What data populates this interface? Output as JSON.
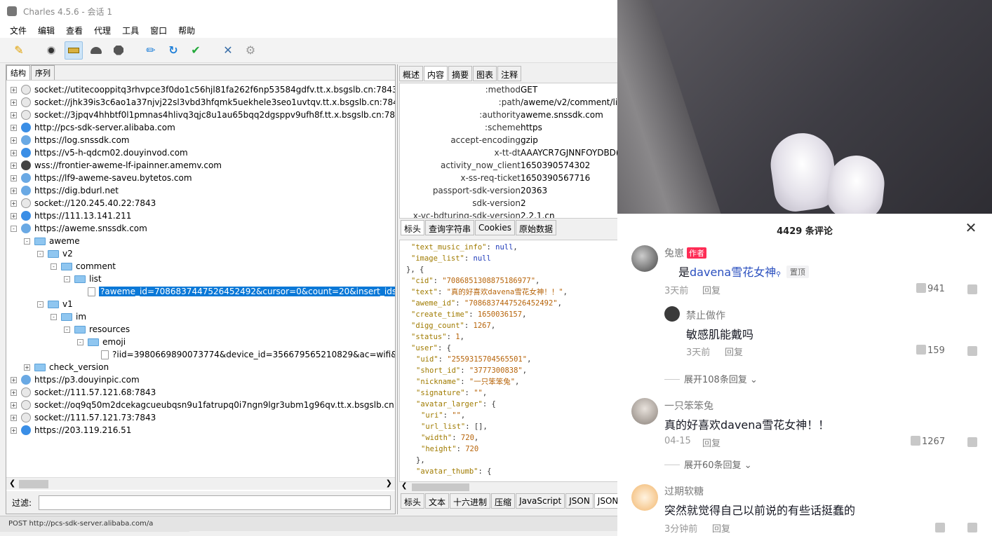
{
  "charles": {
    "title": "Charles 4.5.6 - 会话 1",
    "menu": [
      "文件",
      "编辑",
      "查看",
      "代理",
      "工具",
      "窗口",
      "帮助"
    ],
    "toolbar": [
      "broom-icon",
      "record-icon",
      "throttle-icon",
      "turtle-icon",
      "stop-icon",
      "pen-icon",
      "refresh-icon",
      "check-icon",
      "tools-icon",
      "settings-icon"
    ],
    "left_tabs": [
      "结构",
      "序列"
    ],
    "tree": [
      {
        "depth": 0,
        "exp": "+",
        "icon": "sock",
        "text": "socket://utitecooppitq3rhvpce3f0do1c56hjl81fa262f6np53584gdfv.tt.x.bsgslb.cn:7843"
      },
      {
        "depth": 0,
        "exp": "+",
        "icon": "sock",
        "text": "socket://jhk39is3c6ao1a37njvj22sl3vbd3hfqmk5uekhele3seo1uvtqv.tt.x.bsgslb.cn:7843"
      },
      {
        "depth": 0,
        "exp": "+",
        "icon": "sock",
        "text": "socket://3jpqv4hhbtf0l1pmnas4hlivq3qjc8u1au65bqq2dgsppv9ufh8f.tt.x.bsgslb.cn:7843"
      },
      {
        "depth": 0,
        "exp": "+",
        "icon": "web",
        "text": "http://pcs-sdk-server.alibaba.com"
      },
      {
        "depth": 0,
        "exp": "+",
        "icon": "bolt",
        "text": "https://log.snssdk.com"
      },
      {
        "depth": 0,
        "exp": "+",
        "icon": "web",
        "text": "https://v5-h-qdcm02.douyinvod.com"
      },
      {
        "depth": 0,
        "exp": "+",
        "icon": "wss",
        "text": "wss://frontier-aweme-lf-ipainner.amemv.com"
      },
      {
        "depth": 0,
        "exp": "+",
        "icon": "bolt",
        "text": "https://lf9-aweme-saveu.bytetos.com"
      },
      {
        "depth": 0,
        "exp": "+",
        "icon": "bolt",
        "text": "https://dig.bdurl.net"
      },
      {
        "depth": 0,
        "exp": "+",
        "icon": "sock",
        "text": "socket://120.245.40.22:7843"
      },
      {
        "depth": 0,
        "exp": "+",
        "icon": "web",
        "text": "https://111.13.141.211"
      },
      {
        "depth": 0,
        "exp": "-",
        "icon": "bolt",
        "text": "https://aweme.snssdk.com"
      },
      {
        "depth": 1,
        "exp": "-",
        "icon": "fold",
        "text": "aweme"
      },
      {
        "depth": 2,
        "exp": "-",
        "icon": "fold",
        "text": "v2"
      },
      {
        "depth": 3,
        "exp": "-",
        "icon": "fold",
        "text": "comment"
      },
      {
        "depth": 4,
        "exp": "-",
        "icon": "fold",
        "text": "list"
      },
      {
        "depth": 5,
        "exp": "",
        "icon": "file",
        "text": "?aweme_id=7086837447526452492&cursor=0&count=20&insert_ids&a",
        "selected": true
      },
      {
        "depth": 2,
        "exp": "-",
        "icon": "fold",
        "text": "v1"
      },
      {
        "depth": 3,
        "exp": "-",
        "icon": "fold",
        "text": "im"
      },
      {
        "depth": 4,
        "exp": "-",
        "icon": "fold",
        "text": "resources"
      },
      {
        "depth": 5,
        "exp": "-",
        "icon": "fold",
        "text": "emoji"
      },
      {
        "depth": 6,
        "exp": "",
        "icon": "file",
        "text": "?iid=3980669890073774&device_id=356679565210829&ac=wifi&cha"
      },
      {
        "depth": 1,
        "exp": "+",
        "icon": "fold",
        "text": "check_version"
      },
      {
        "depth": 0,
        "exp": "+",
        "icon": "bolt",
        "text": "https://p3.douyinpic.com"
      },
      {
        "depth": 0,
        "exp": "+",
        "icon": "sock",
        "text": "socket://111.57.121.68:7843"
      },
      {
        "depth": 0,
        "exp": "+",
        "icon": "sock",
        "text": "socket://oq9q50m2dcekagcueubqsn9u1fatrupq0i7ngn9lgr3ubm1g96qv.tt.x.bsgslb.cn:78"
      },
      {
        "depth": 0,
        "exp": "+",
        "icon": "sock",
        "text": "socket://111.57.121.73:7843"
      },
      {
        "depth": 0,
        "exp": "+",
        "icon": "web",
        "text": "https://203.119.216.51"
      }
    ],
    "filter_label": "过滤:",
    "filter_value": "",
    "right_tabs": [
      "概述",
      "内容",
      "摘要",
      "图表",
      "注释"
    ],
    "headers": [
      {
        "k": ":method",
        "v": "GET"
      },
      {
        "k": ":path",
        "v": "/aweme/v2/comment/lis"
      },
      {
        "k": ":authority",
        "v": "aweme.snssdk.com"
      },
      {
        "k": ":scheme",
        "v": "https"
      },
      {
        "k": "accept-encoding",
        "v": "gzip"
      },
      {
        "k": "x-tt-dt",
        "v": "AAAYCR7GJNNFOYDBD("
      },
      {
        "k": "activity_now_client",
        "v": "1650390574302"
      },
      {
        "k": "x-ss-req-ticket",
        "v": "1650390567716"
      },
      {
        "k": "passport-sdk-version",
        "v": "20363"
      },
      {
        "k": "sdk-version",
        "v": "2"
      },
      {
        "k": "x-vc-bdturing-sdk-version",
        "v": "2.2.1.cn"
      }
    ],
    "req_tabs": [
      "标头",
      "查询字符串",
      "Cookies",
      "原始数据"
    ],
    "json_lines": [
      {
        "ind": 2,
        "parts": [
          [
            "k",
            "\"text_music_info\""
          ],
          [
            "p",
            ": "
          ],
          [
            "b",
            "null"
          ],
          [
            "p",
            ","
          ]
        ]
      },
      {
        "ind": 2,
        "parts": [
          [
            "k",
            "\"image_list\""
          ],
          [
            "p",
            ": "
          ],
          [
            "b",
            "null"
          ]
        ]
      },
      {
        "ind": 1,
        "parts": [
          [
            "p",
            "}, {"
          ]
        ]
      },
      {
        "ind": 2,
        "parts": [
          [
            "k",
            "\"cid\""
          ],
          [
            "p",
            ": "
          ],
          [
            "s",
            "\"7086851308875186977\""
          ],
          [
            "p",
            ","
          ]
        ]
      },
      {
        "ind": 2,
        "parts": [
          [
            "k",
            "\"text\""
          ],
          [
            "p",
            ": "
          ],
          [
            "s",
            "\"真的好喜欢davena雪花女神！！\""
          ],
          [
            "p",
            ","
          ]
        ]
      },
      {
        "ind": 2,
        "parts": [
          [
            "k",
            "\"aweme_id\""
          ],
          [
            "p",
            ": "
          ],
          [
            "s",
            "\"7086837447526452492\""
          ],
          [
            "p",
            ","
          ]
        ]
      },
      {
        "ind": 2,
        "parts": [
          [
            "k",
            "\"create_time\""
          ],
          [
            "p",
            ": "
          ],
          [
            "n",
            "1650036157"
          ],
          [
            "p",
            ","
          ]
        ]
      },
      {
        "ind": 2,
        "parts": [
          [
            "k",
            "\"digg_count\""
          ],
          [
            "p",
            ": "
          ],
          [
            "n",
            "1267"
          ],
          [
            "p",
            ","
          ]
        ]
      },
      {
        "ind": 2,
        "parts": [
          [
            "k",
            "\"status\""
          ],
          [
            "p",
            ": "
          ],
          [
            "n",
            "1"
          ],
          [
            "p",
            ","
          ]
        ]
      },
      {
        "ind": 2,
        "parts": [
          [
            "k",
            "\"user\""
          ],
          [
            "p",
            ": {"
          ]
        ]
      },
      {
        "ind": 3,
        "parts": [
          [
            "k",
            "\"uid\""
          ],
          [
            "p",
            ": "
          ],
          [
            "s",
            "\"2559315704565501\""
          ],
          [
            "p",
            ","
          ]
        ]
      },
      {
        "ind": 3,
        "parts": [
          [
            "k",
            "\"short_id\""
          ],
          [
            "p",
            ": "
          ],
          [
            "s",
            "\"3777300838\""
          ],
          [
            "p",
            ","
          ]
        ]
      },
      {
        "ind": 3,
        "parts": [
          [
            "k",
            "\"nickname\""
          ],
          [
            "p",
            ": "
          ],
          [
            "s",
            "\"一只笨笨兔\""
          ],
          [
            "p",
            ","
          ]
        ]
      },
      {
        "ind": 3,
        "parts": [
          [
            "k",
            "\"signature\""
          ],
          [
            "p",
            ": "
          ],
          [
            "s",
            "\"\""
          ],
          [
            "p",
            ","
          ]
        ]
      },
      {
        "ind": 3,
        "parts": [
          [
            "k",
            "\"avatar_larger\""
          ],
          [
            "p",
            ": {"
          ]
        ]
      },
      {
        "ind": 4,
        "parts": [
          [
            "k",
            "\"uri\""
          ],
          [
            "p",
            ": "
          ],
          [
            "s",
            "\"\""
          ],
          [
            "p",
            ","
          ]
        ]
      },
      {
        "ind": 4,
        "parts": [
          [
            "k",
            "\"url_list\""
          ],
          [
            "p",
            ": [],"
          ]
        ]
      },
      {
        "ind": 4,
        "parts": [
          [
            "k",
            "\"width\""
          ],
          [
            "p",
            ": "
          ],
          [
            "n",
            "720"
          ],
          [
            "p",
            ","
          ]
        ]
      },
      {
        "ind": 4,
        "parts": [
          [
            "k",
            "\"height\""
          ],
          [
            "p",
            ": "
          ],
          [
            "n",
            "720"
          ]
        ]
      },
      {
        "ind": 3,
        "parts": [
          [
            "p",
            "},"
          ]
        ]
      },
      {
        "ind": 3,
        "parts": [
          [
            "k",
            "\"avatar_thumb\""
          ],
          [
            "p",
            ": {"
          ]
        ]
      }
    ],
    "resp_tabs": [
      "标头",
      "文本",
      "十六进制",
      "压缩",
      "JavaScript",
      "JSON",
      "JSON"
    ],
    "status": "POST http://pcs-sdk-server.alibaba.com/a"
  },
  "comments": {
    "header": "4429 条评论",
    "items": [
      {
        "user": "兔崽",
        "badge": "作者",
        "text_prefix": "是",
        "hashtag": "davena雪花女神",
        "pinned": "置顶",
        "time": "3天前",
        "reply": "回复",
        "likes": "941",
        "avatar_color": "#555"
      },
      {
        "user": "禁止做作",
        "text": "敏感肌能戴吗",
        "time": "3天前",
        "reply": "回复",
        "likes": "159",
        "avatar_color": "#3a3a3a"
      },
      {
        "user": "一只笨笨兔",
        "text": "真的好喜欢davena雪花女神！！",
        "time": "04-15",
        "reply": "回复",
        "likes": "1267",
        "avatar_color": "#b9b0a8"
      },
      {
        "user": "过期软糖",
        "text": "突然就觉得自己以前说的有些话挺蠢的",
        "time": "3分钟前",
        "reply": "回复",
        "likes": "",
        "avatar_color": "#f2b66d"
      }
    ],
    "expand_1": "展开108条回复",
    "expand_2": "展开60条回复"
  }
}
